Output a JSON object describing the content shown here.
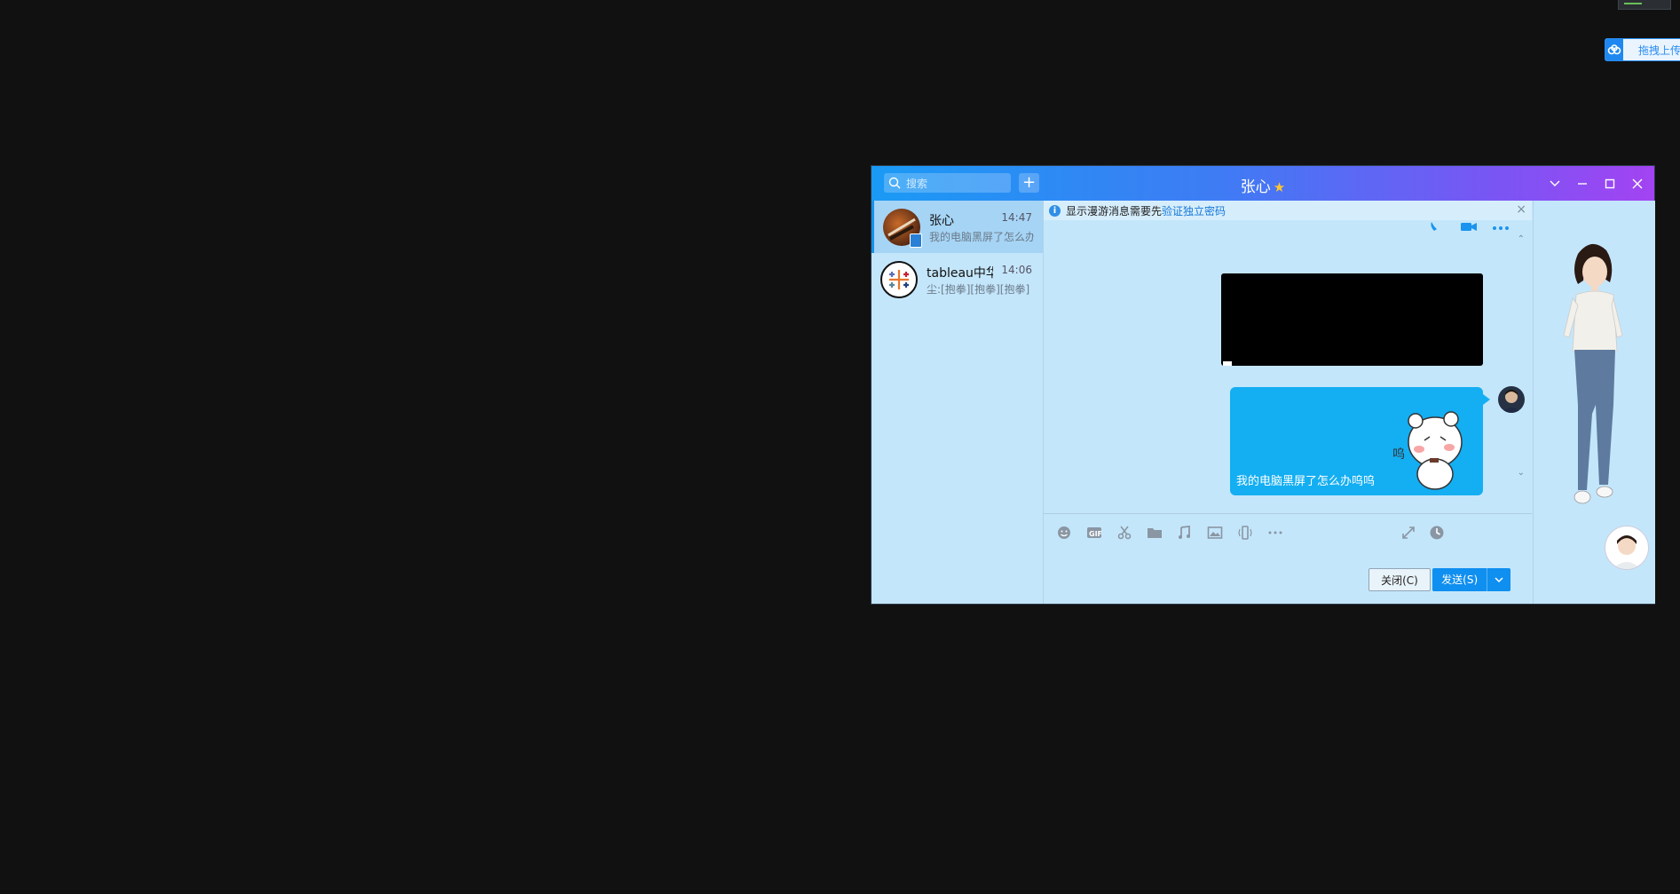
{
  "desktop": {
    "upload_label": "拖拽上传"
  },
  "window": {
    "title": "张心",
    "search_placeholder": "搜索",
    "add_symbol": "+",
    "colors": {
      "title_start": "#1a9af5",
      "title_end": "#a343f2",
      "accent": "#0f8ff0",
      "panel_bg": "#c4e6fb"
    }
  },
  "contacts": [
    {
      "name": "张心",
      "time": "14:47",
      "preview": "我的电脑黑屏了怎么办",
      "active": true
    },
    {
      "name": "tableau中华",
      "time": "14:06",
      "preview": "尘:[抱拳][抱拳][抱拳]",
      "active": false
    }
  ],
  "notice": {
    "text": "显示漫游消息需要先",
    "link": "验证独立密码",
    "close": "×"
  },
  "messages": [
    {
      "type": "image",
      "content": "black-screen-image"
    },
    {
      "type": "text_sticker",
      "text": "我的电脑黑屏了怎么办呜呜"
    }
  ],
  "toolbar": {
    "icons": [
      "emoji-icon",
      "gif-icon",
      "scissors-icon",
      "folder-icon",
      "music-icon",
      "image-icon",
      "shake-icon",
      "more-icon"
    ],
    "right_icons": [
      "expand-icon",
      "history-icon"
    ]
  },
  "buttons": {
    "close_label": "关闭(C)",
    "send_label": "发送(S)"
  },
  "title_controls": [
    "chevron-down-icon",
    "minimize-icon",
    "maximize-icon",
    "close-icon"
  ]
}
